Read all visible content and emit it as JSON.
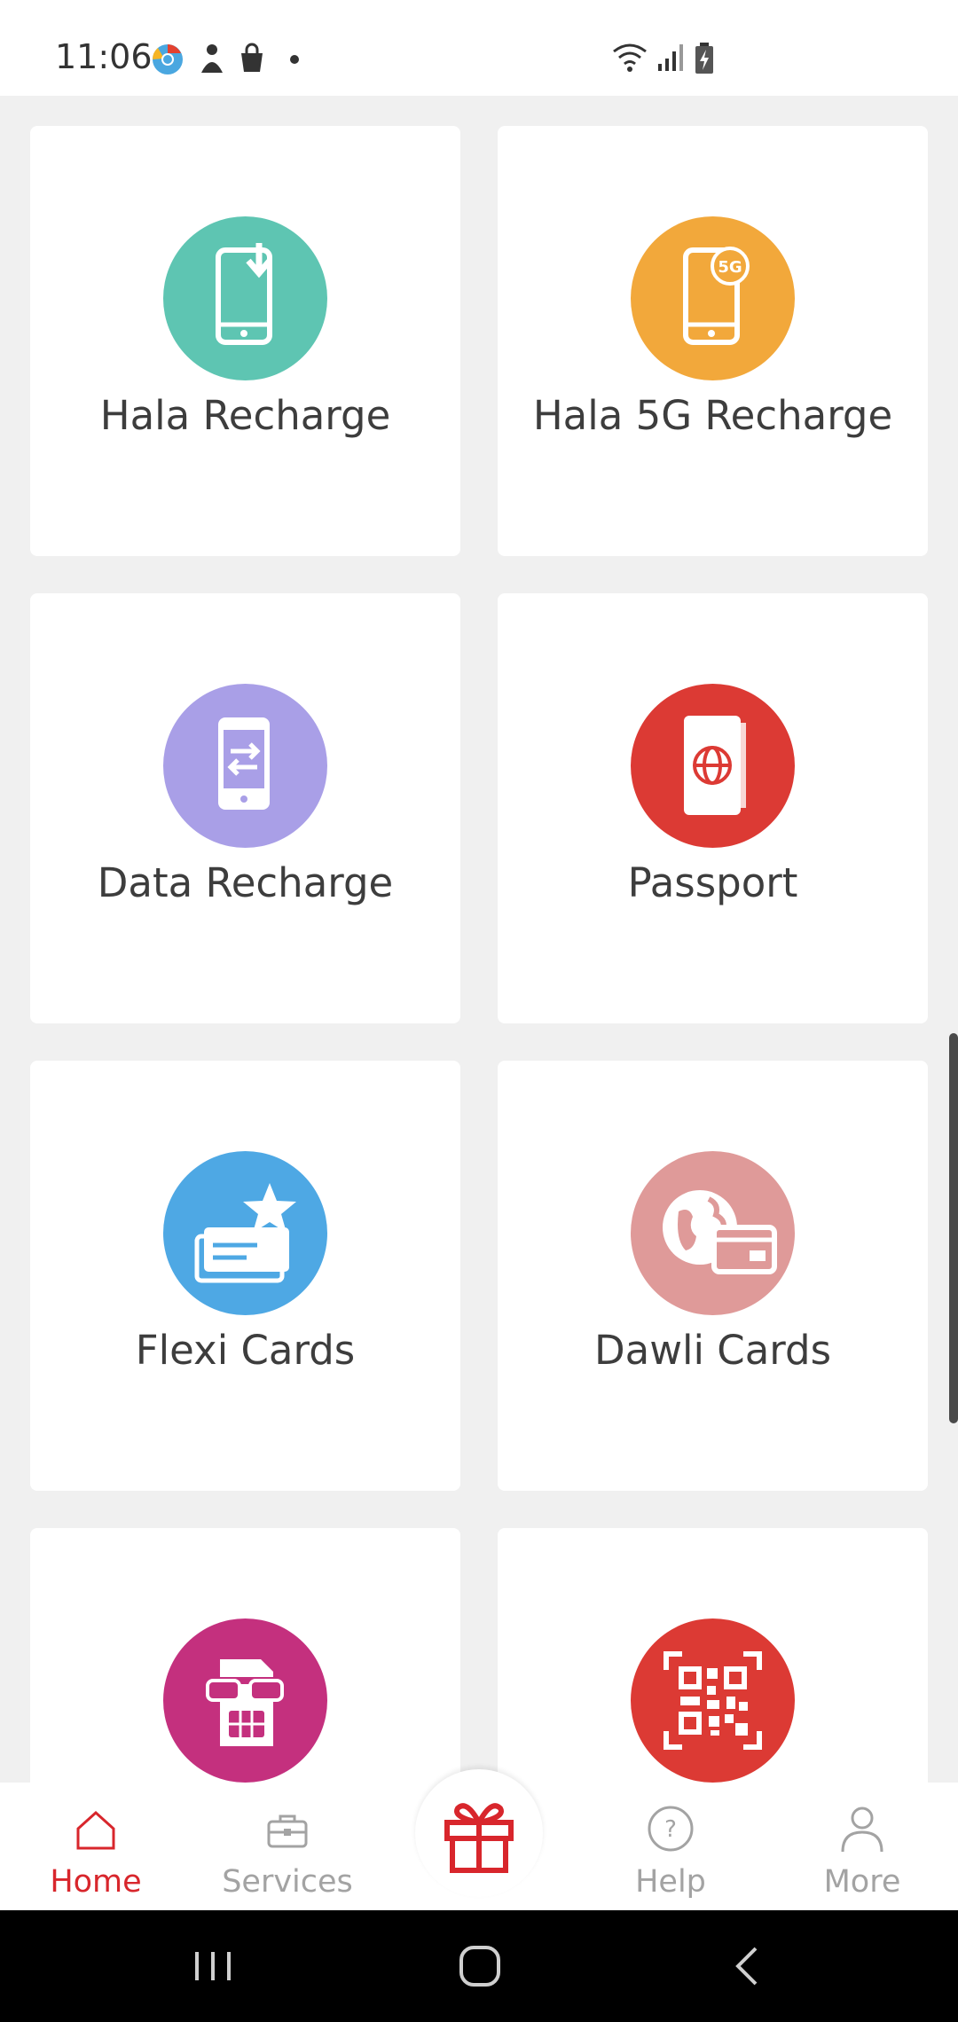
{
  "status_bar": {
    "time": "11:06",
    "notification_icons": [
      "chrome-icon",
      "app-icon",
      "shopping-bag-icon",
      "dot-icon"
    ],
    "system_icons": [
      "wifi-icon",
      "signal-icon",
      "battery-charging-icon"
    ]
  },
  "services": [
    {
      "label": "Hala Recharge",
      "icon": "phone-download-icon",
      "color": "#5ec5b2"
    },
    {
      "label": "Hala 5G Recharge",
      "icon": "phone-5g-icon",
      "color": "#f2a83b"
    },
    {
      "label": "Data Recharge",
      "icon": "phone-exchange-icon",
      "color": "#a99fe7"
    },
    {
      "label": "Passport",
      "icon": "passport-icon",
      "color": "#dc3a34"
    },
    {
      "label": "Flexi Cards",
      "icon": "cards-star-icon",
      "color": "#4ea8e4"
    },
    {
      "label": "Dawli Cards",
      "icon": "globe-card-icon",
      "color": "#df9a99"
    },
    {
      "label": "",
      "icon": "sim-glasses-icon",
      "color": "#c4307e"
    },
    {
      "label": "",
      "icon": "qr-code-icon",
      "color": "#dc3a34"
    }
  ],
  "bottom_nav": {
    "items": [
      {
        "label": "Home",
        "icon": "home-icon",
        "active": true
      },
      {
        "label": "Services",
        "icon": "briefcase-icon",
        "active": false
      },
      {
        "label": "",
        "icon": "gift-icon",
        "active": false
      },
      {
        "label": "Help",
        "icon": "help-icon",
        "active": false
      },
      {
        "label": "More",
        "icon": "person-icon",
        "active": false
      }
    ],
    "active_color": "#d8262c",
    "inactive_color": "#a3a3a3"
  },
  "system_nav": [
    "recent-apps-icon",
    "home-circle-icon",
    "back-icon"
  ]
}
